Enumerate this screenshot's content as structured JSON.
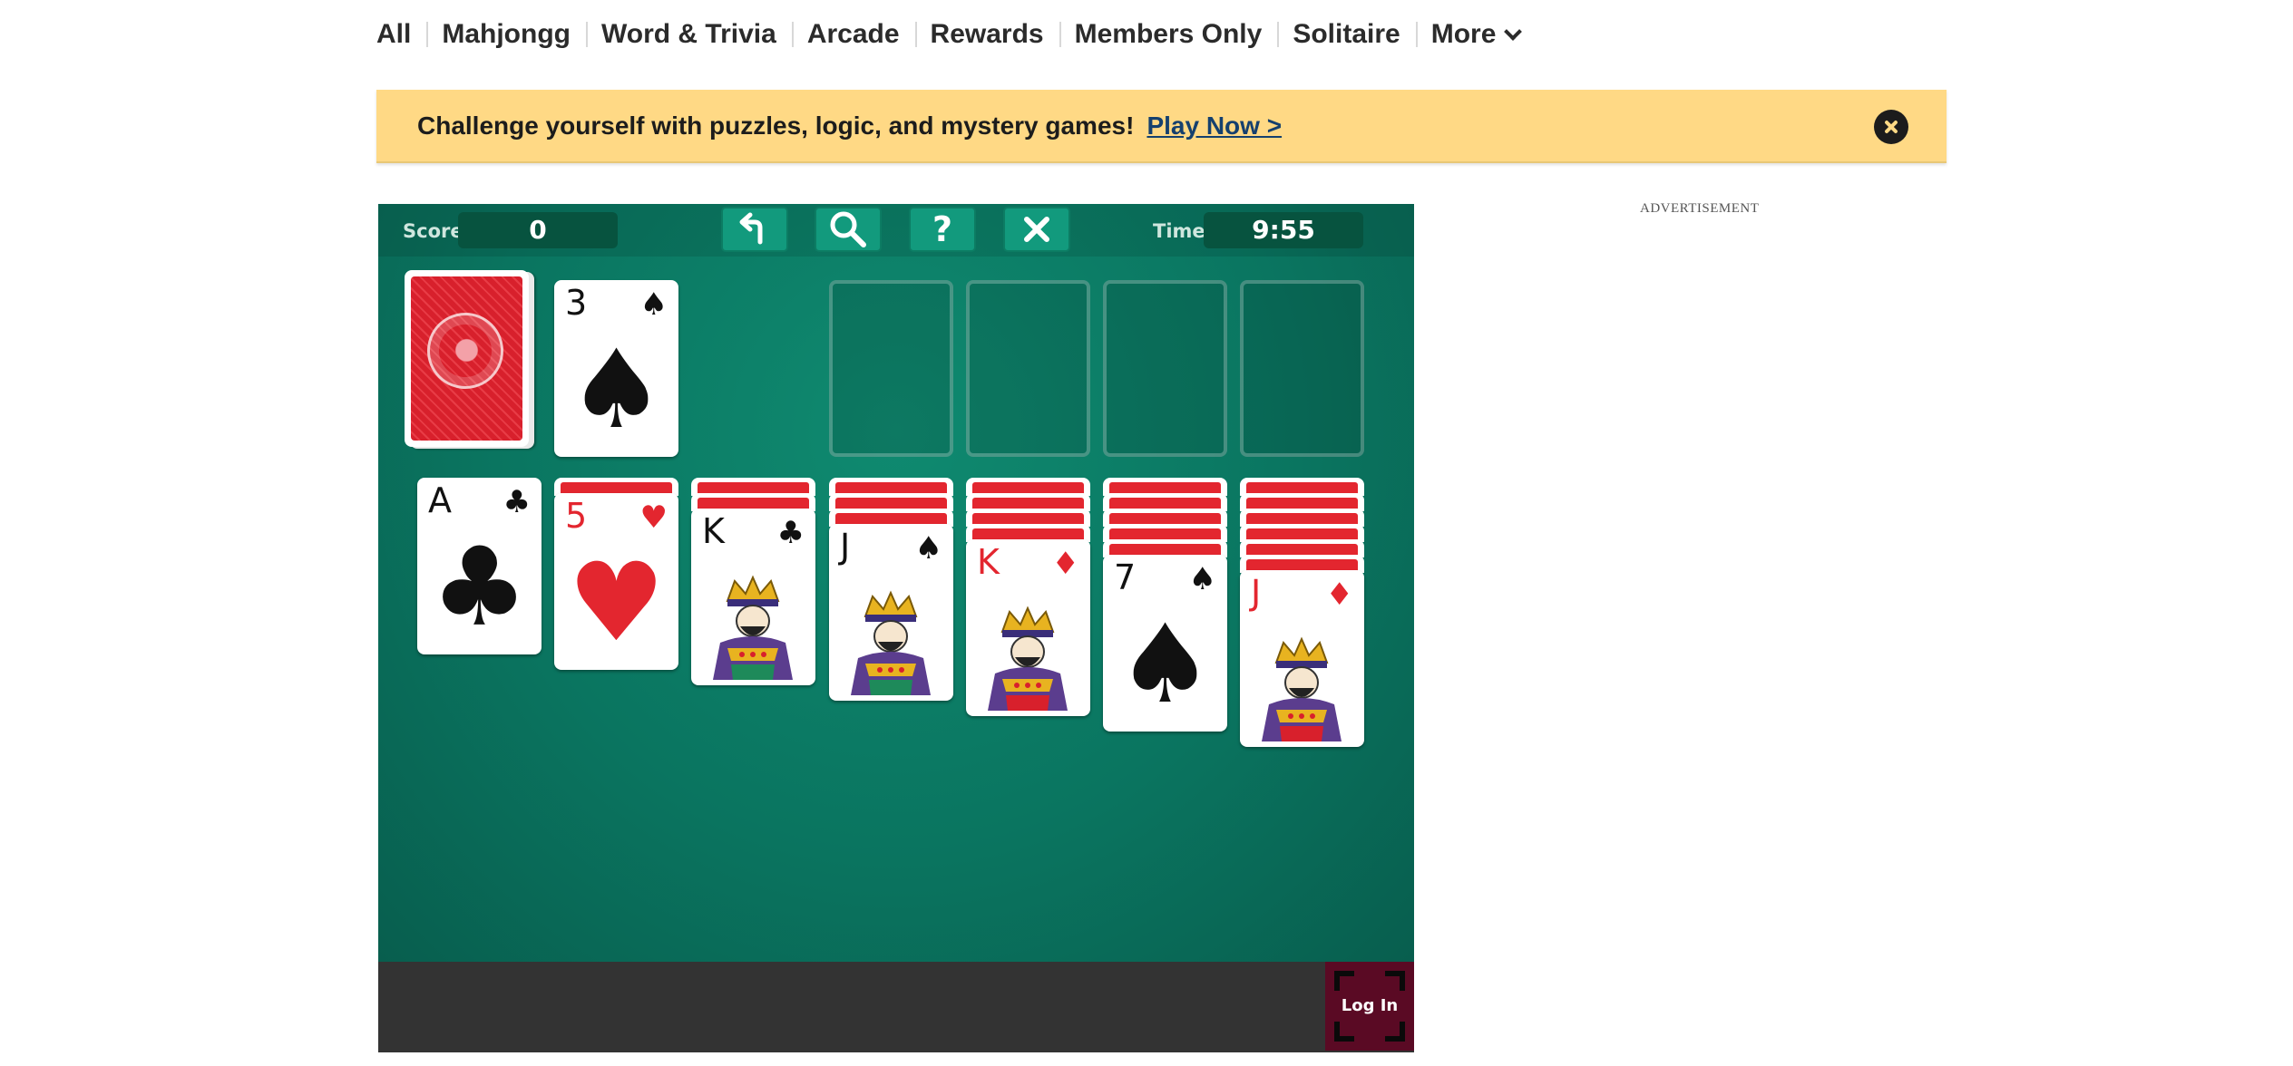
{
  "nav": {
    "items": [
      "All",
      "Mahjongg",
      "Word & Trivia",
      "Arcade",
      "Rewards",
      "Members Only",
      "Solitaire"
    ],
    "more_label": "More",
    "more_icon": "chevron-down-icon"
  },
  "banner": {
    "text": "Challenge yourself with puzzles, logic, and mystery games!",
    "link": "Play Now >",
    "close_icon": "close-icon"
  },
  "ad": {
    "label": "ADVERTISEMENT"
  },
  "game": {
    "score_label": "Score",
    "score_value": "0",
    "time_label": "Time",
    "time_value": "9:55",
    "toolbar": {
      "undo_icon": "undo-icon",
      "hint_icon": "magnifier-icon",
      "help_label": "?",
      "close_icon": "close-icon"
    },
    "waste_card": {
      "rank": "3",
      "suit": "♠",
      "color": "black"
    },
    "tableau": [
      {
        "rank": "A",
        "suit": "♣",
        "color": "black",
        "kind": "pip",
        "facedown": 0
      },
      {
        "rank": "5",
        "suit": "♥",
        "color": "red",
        "kind": "pip",
        "facedown": 1
      },
      {
        "rank": "K",
        "suit": "♣",
        "color": "black",
        "kind": "face",
        "facedown": 2
      },
      {
        "rank": "J",
        "suit": "♠",
        "color": "black",
        "kind": "face",
        "facedown": 3
      },
      {
        "rank": "K",
        "suit": "♦",
        "color": "red",
        "kind": "face",
        "facedown": 4
      },
      {
        "rank": "7",
        "suit": "♠",
        "color": "black",
        "kind": "pip",
        "facedown": 5
      },
      {
        "rank": "J",
        "suit": "♦",
        "color": "red",
        "kind": "face",
        "facedown": 6
      }
    ],
    "login_label": "Log In"
  },
  "colors": {
    "felt": "#0a7560",
    "banner": "#ffd985",
    "card_red": "#e3262f",
    "login_bg": "#5a0a24"
  }
}
